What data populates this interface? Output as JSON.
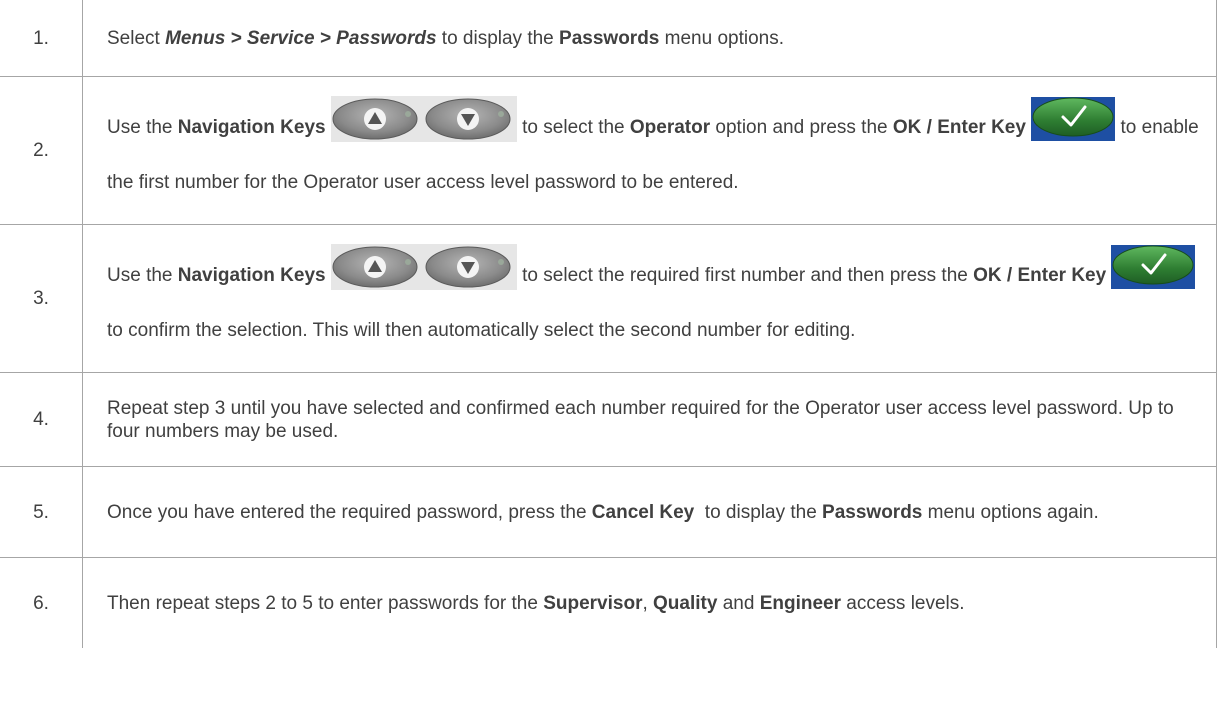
{
  "steps": [
    {
      "num": "1.",
      "parts": [
        "Select ",
        "Menus > Service > Passwords",
        " to display the ",
        "Passwords",
        " menu options."
      ]
    },
    {
      "num": "2.",
      "parts": [
        "Use the ",
        "Navigation Keys",
        " to select the ",
        "Operator",
        " option and press the ",
        "OK / Enter Key",
        " to enable the first number for the Operator user access level password to be entered."
      ]
    },
    {
      "num": "3.",
      "parts": [
        "Use the ",
        "Navigation Keys",
        " to select the required first number and then press the ",
        "OK / Enter Key",
        " to confirm the selection. This will then automatically select the second number for editing."
      ]
    },
    {
      "num": "4.",
      "parts": [
        "Repeat step 3 until you have selected and confirmed each number required for the Operator user access level password. Up to four numbers may be used."
      ]
    },
    {
      "num": "5.",
      "parts": [
        "Once you have entered the required password, press the ",
        "Cancel Key",
        "  to display the ",
        "Passwords",
        " menu options again."
      ]
    },
    {
      "num": "6.",
      "parts": [
        "Then repeat steps 2 to 5 to enter passwords for the ",
        "Supervisor",
        ", ",
        "Quality",
        " and ",
        "Engineer",
        " access levels."
      ]
    }
  ],
  "icons": {
    "nav_up": "nav-up-key-icon",
    "nav_down": "nav-down-key-icon",
    "ok_enter": "ok-enter-key-icon"
  },
  "colors": {
    "text": "#404040",
    "border": "#a6a6a6",
    "ok_key_green": "#2e7d32",
    "ok_key_blue": "#1e4fa3",
    "nav_key_gray": "#8a8a8a"
  }
}
